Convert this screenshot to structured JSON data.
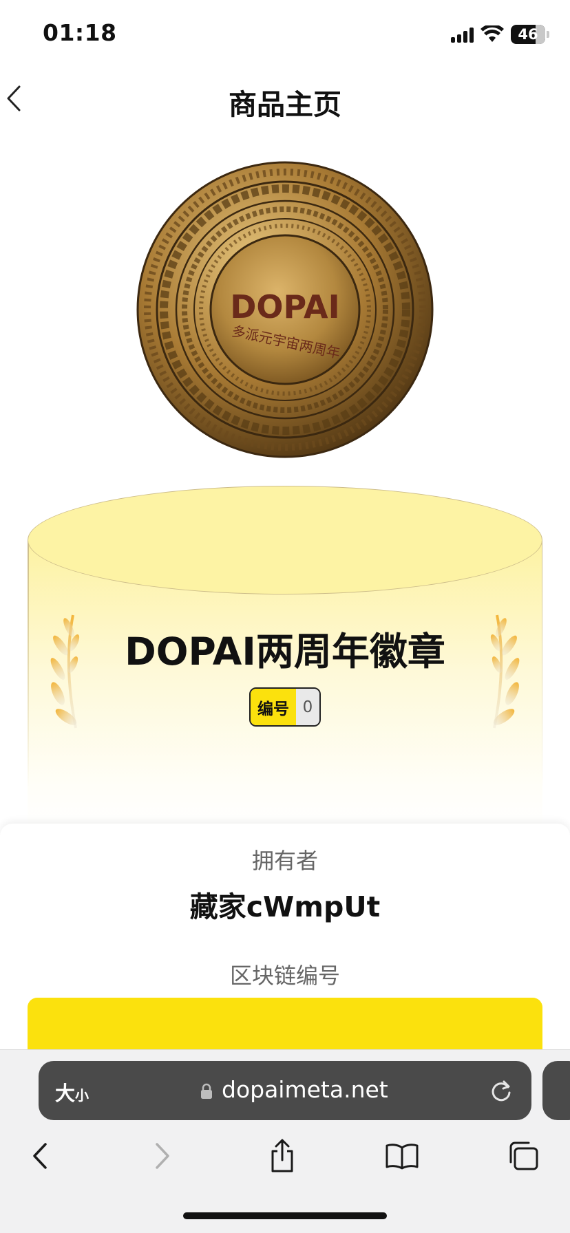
{
  "status_bar": {
    "time": "01:18",
    "battery": "46"
  },
  "nav": {
    "title": "商品主页"
  },
  "product": {
    "name": "DOPAI两周年徽章",
    "serial_label": "编号",
    "serial_value": "0",
    "coin_text": "DOPAI",
    "coin_subtext": "多派元宇宙两周年"
  },
  "owner": {
    "label": "拥有者",
    "name": "藏家cWmpUt"
  },
  "chain": {
    "label": "区块链编号"
  },
  "browser": {
    "text_size_big": "大",
    "text_size_small": "小",
    "url": "dopaimeta.net"
  },
  "colors": {
    "accent_yellow": "#fbe10d",
    "podium_yellow": "#fdf3a4",
    "gold": "#b8893a"
  }
}
